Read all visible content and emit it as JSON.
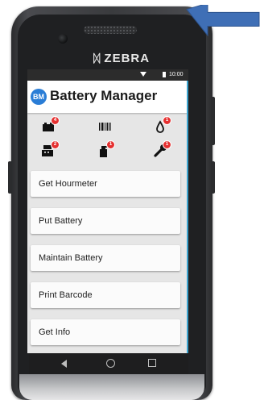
{
  "device": {
    "brand": "ZEBRA"
  },
  "status_bar": {
    "time": "10:00"
  },
  "app": {
    "logo_text": "BM",
    "title": "Battery Manager"
  },
  "status_icons": [
    {
      "name": "charger-icon",
      "badge": "4"
    },
    {
      "name": "barcode-icon",
      "badge": ""
    },
    {
      "name": "water-drop-icon",
      "badge": "1"
    },
    {
      "name": "register-icon",
      "badge": "2"
    },
    {
      "name": "spray-bottle-icon",
      "badge": "1"
    },
    {
      "name": "wrench-icon",
      "badge": "1"
    }
  ],
  "menu": {
    "get_hourmeter": "Get Hourmeter",
    "put_battery": "Put Battery",
    "maintain_battery": "Maintain Battery",
    "print_barcode": "Print Barcode",
    "get_info": "Get Info"
  },
  "colors": {
    "accent": "#2a7dd6",
    "badge": "#e53030",
    "arrow": "#3f6fb6"
  }
}
